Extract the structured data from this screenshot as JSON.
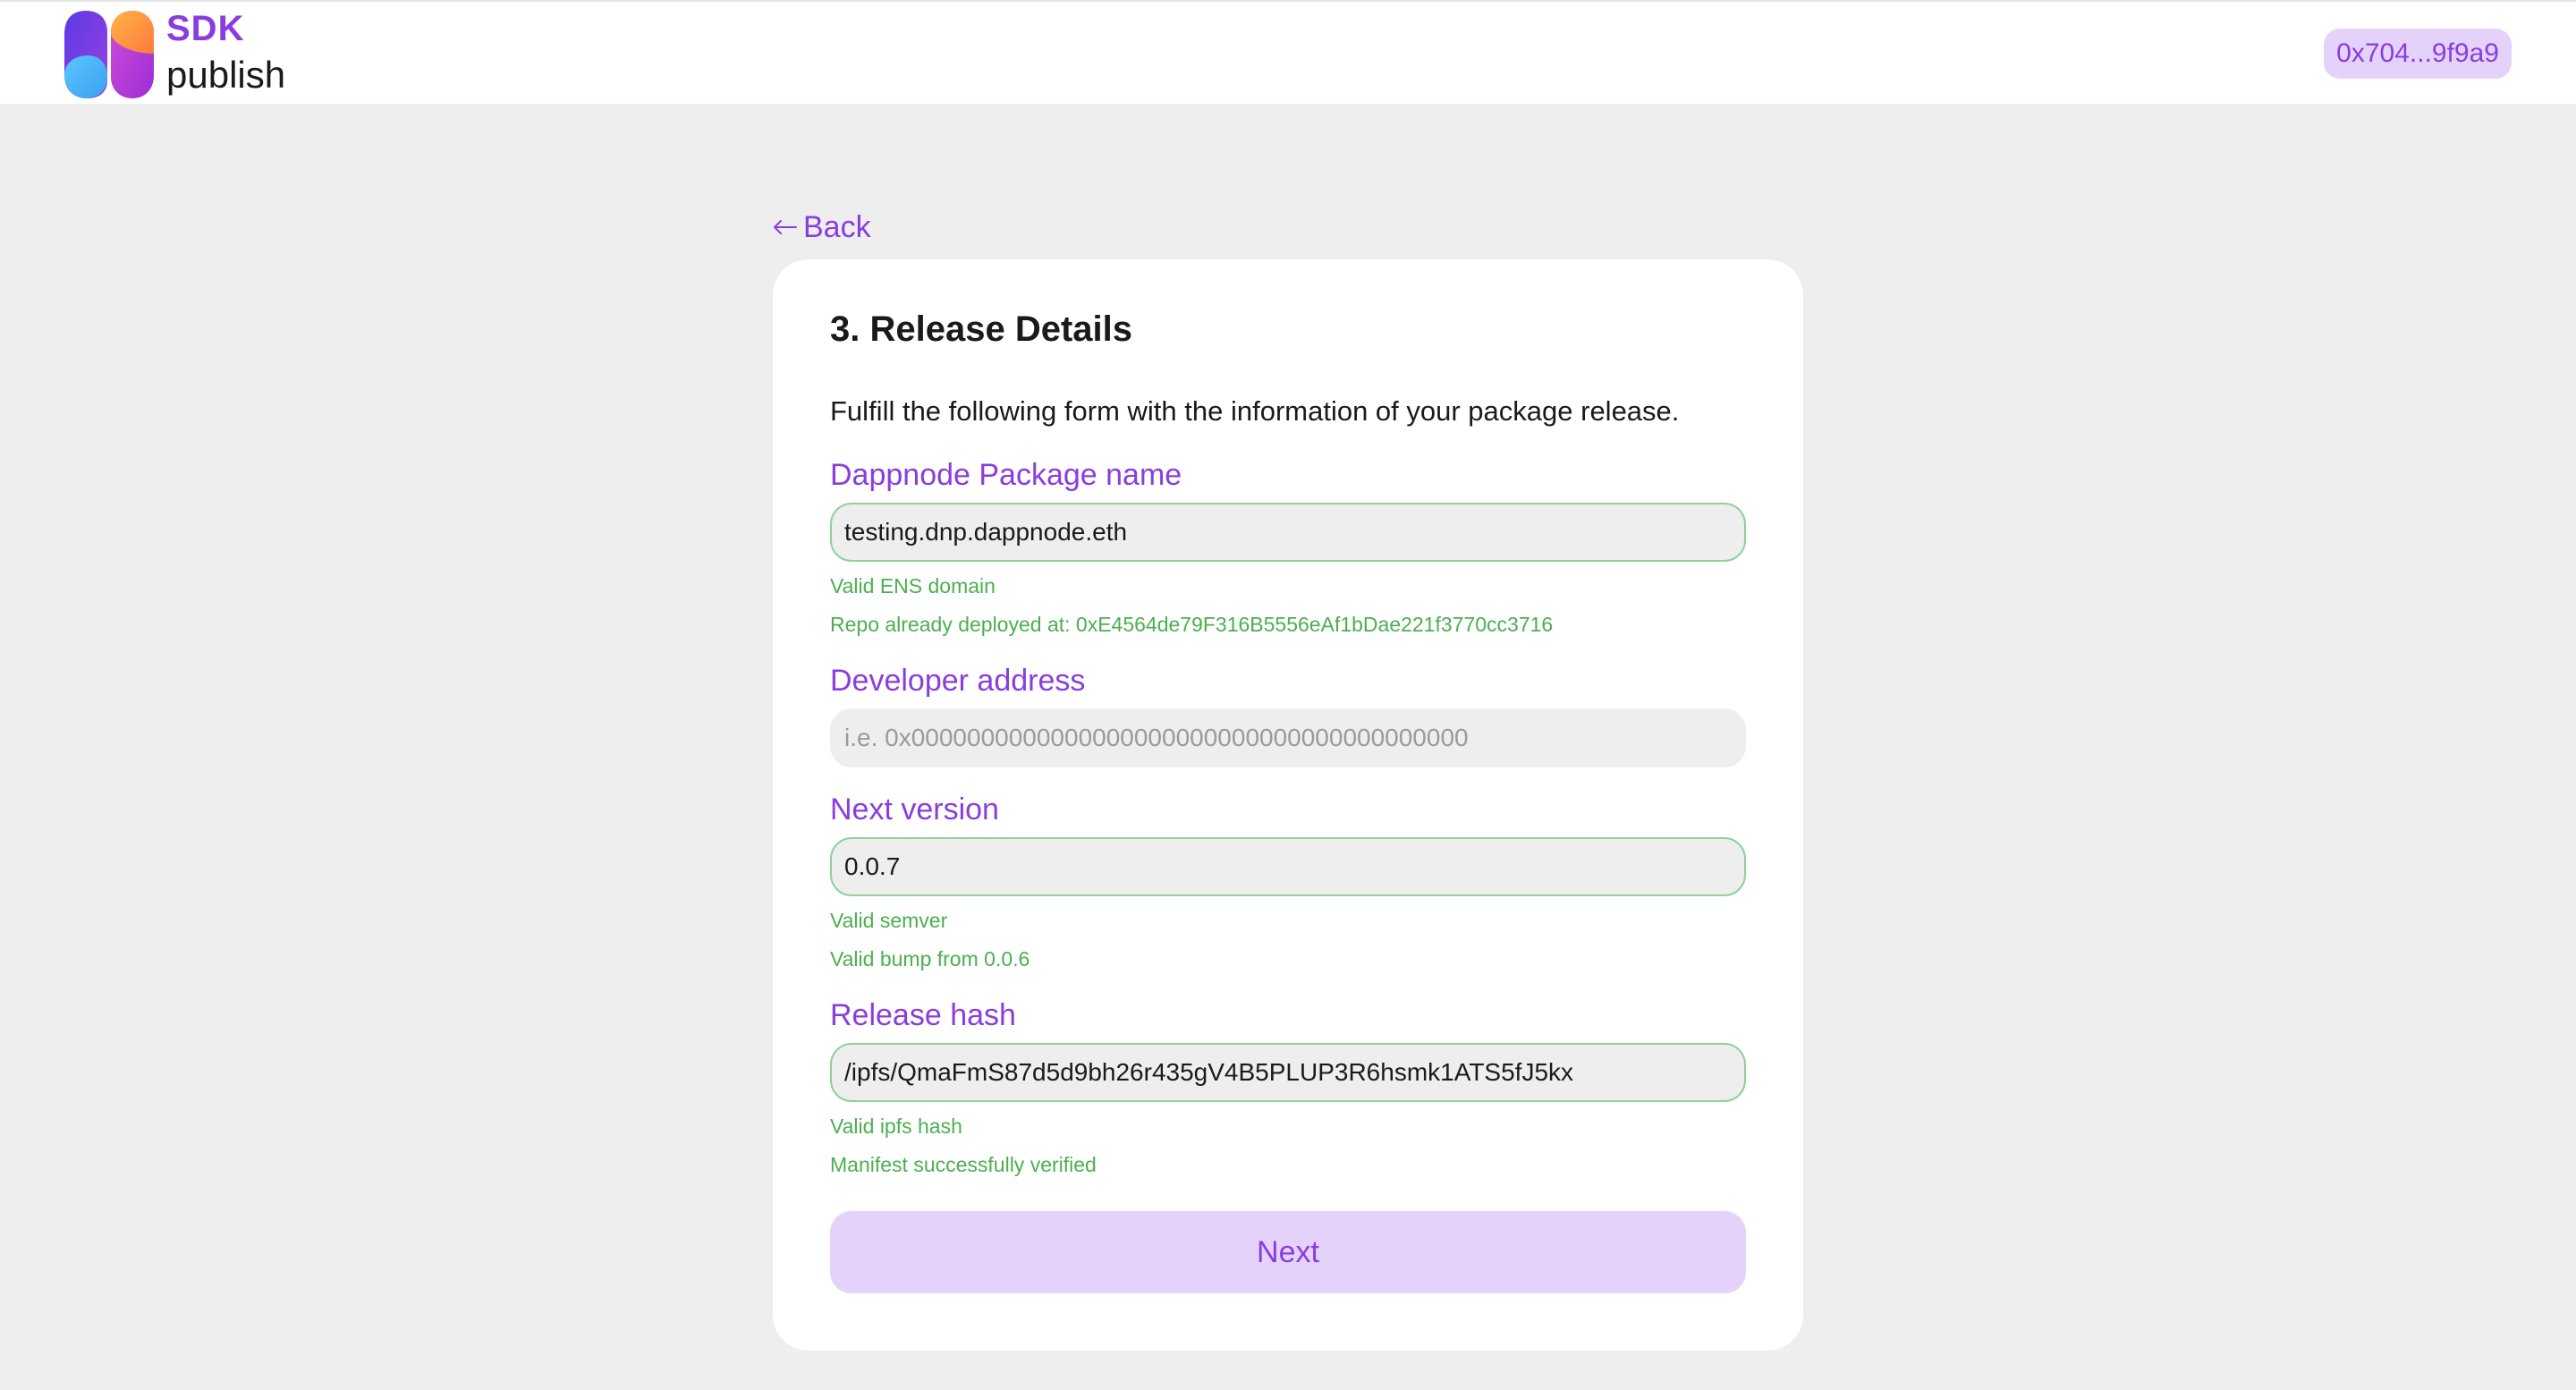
{
  "header": {
    "brand_top": "SDK",
    "brand_bottom": "publish",
    "account": "0x704...9f9a9"
  },
  "nav": {
    "back_label": "Back"
  },
  "form": {
    "title": "3. Release Details",
    "description": "Fulfill the following form with the information of your package release.",
    "package_name": {
      "label": "Dappnode Package name",
      "value": "testing.dnp.dappnode.eth",
      "hints": [
        "Valid ENS domain",
        "Repo already deployed at: 0xE4564de79F316B5556eAf1bDae221f3770cc3716"
      ]
    },
    "developer_address": {
      "label": "Developer address",
      "value": "",
      "placeholder": "i.e. 0x0000000000000000000000000000000000000000"
    },
    "next_version": {
      "label": "Next version",
      "value": "0.0.7",
      "hints": [
        "Valid semver",
        "Valid bump from 0.0.6"
      ]
    },
    "release_hash": {
      "label": "Release hash",
      "value": "/ipfs/QmaFmS87d5d9bh26r435gV4B5PLUP3R6hsmk1ATS5fJ5kx",
      "hints": [
        "Valid ipfs hash",
        "Manifest successfully verified"
      ]
    },
    "next_label": "Next"
  },
  "colors": {
    "accent": "#8a3ddf",
    "accent_light": "#e4d2fb",
    "success": "#4caf50",
    "background": "#eeeeee"
  },
  "icons": {
    "logo": "sdk-publish-logo",
    "back": "arrow-left-icon"
  }
}
